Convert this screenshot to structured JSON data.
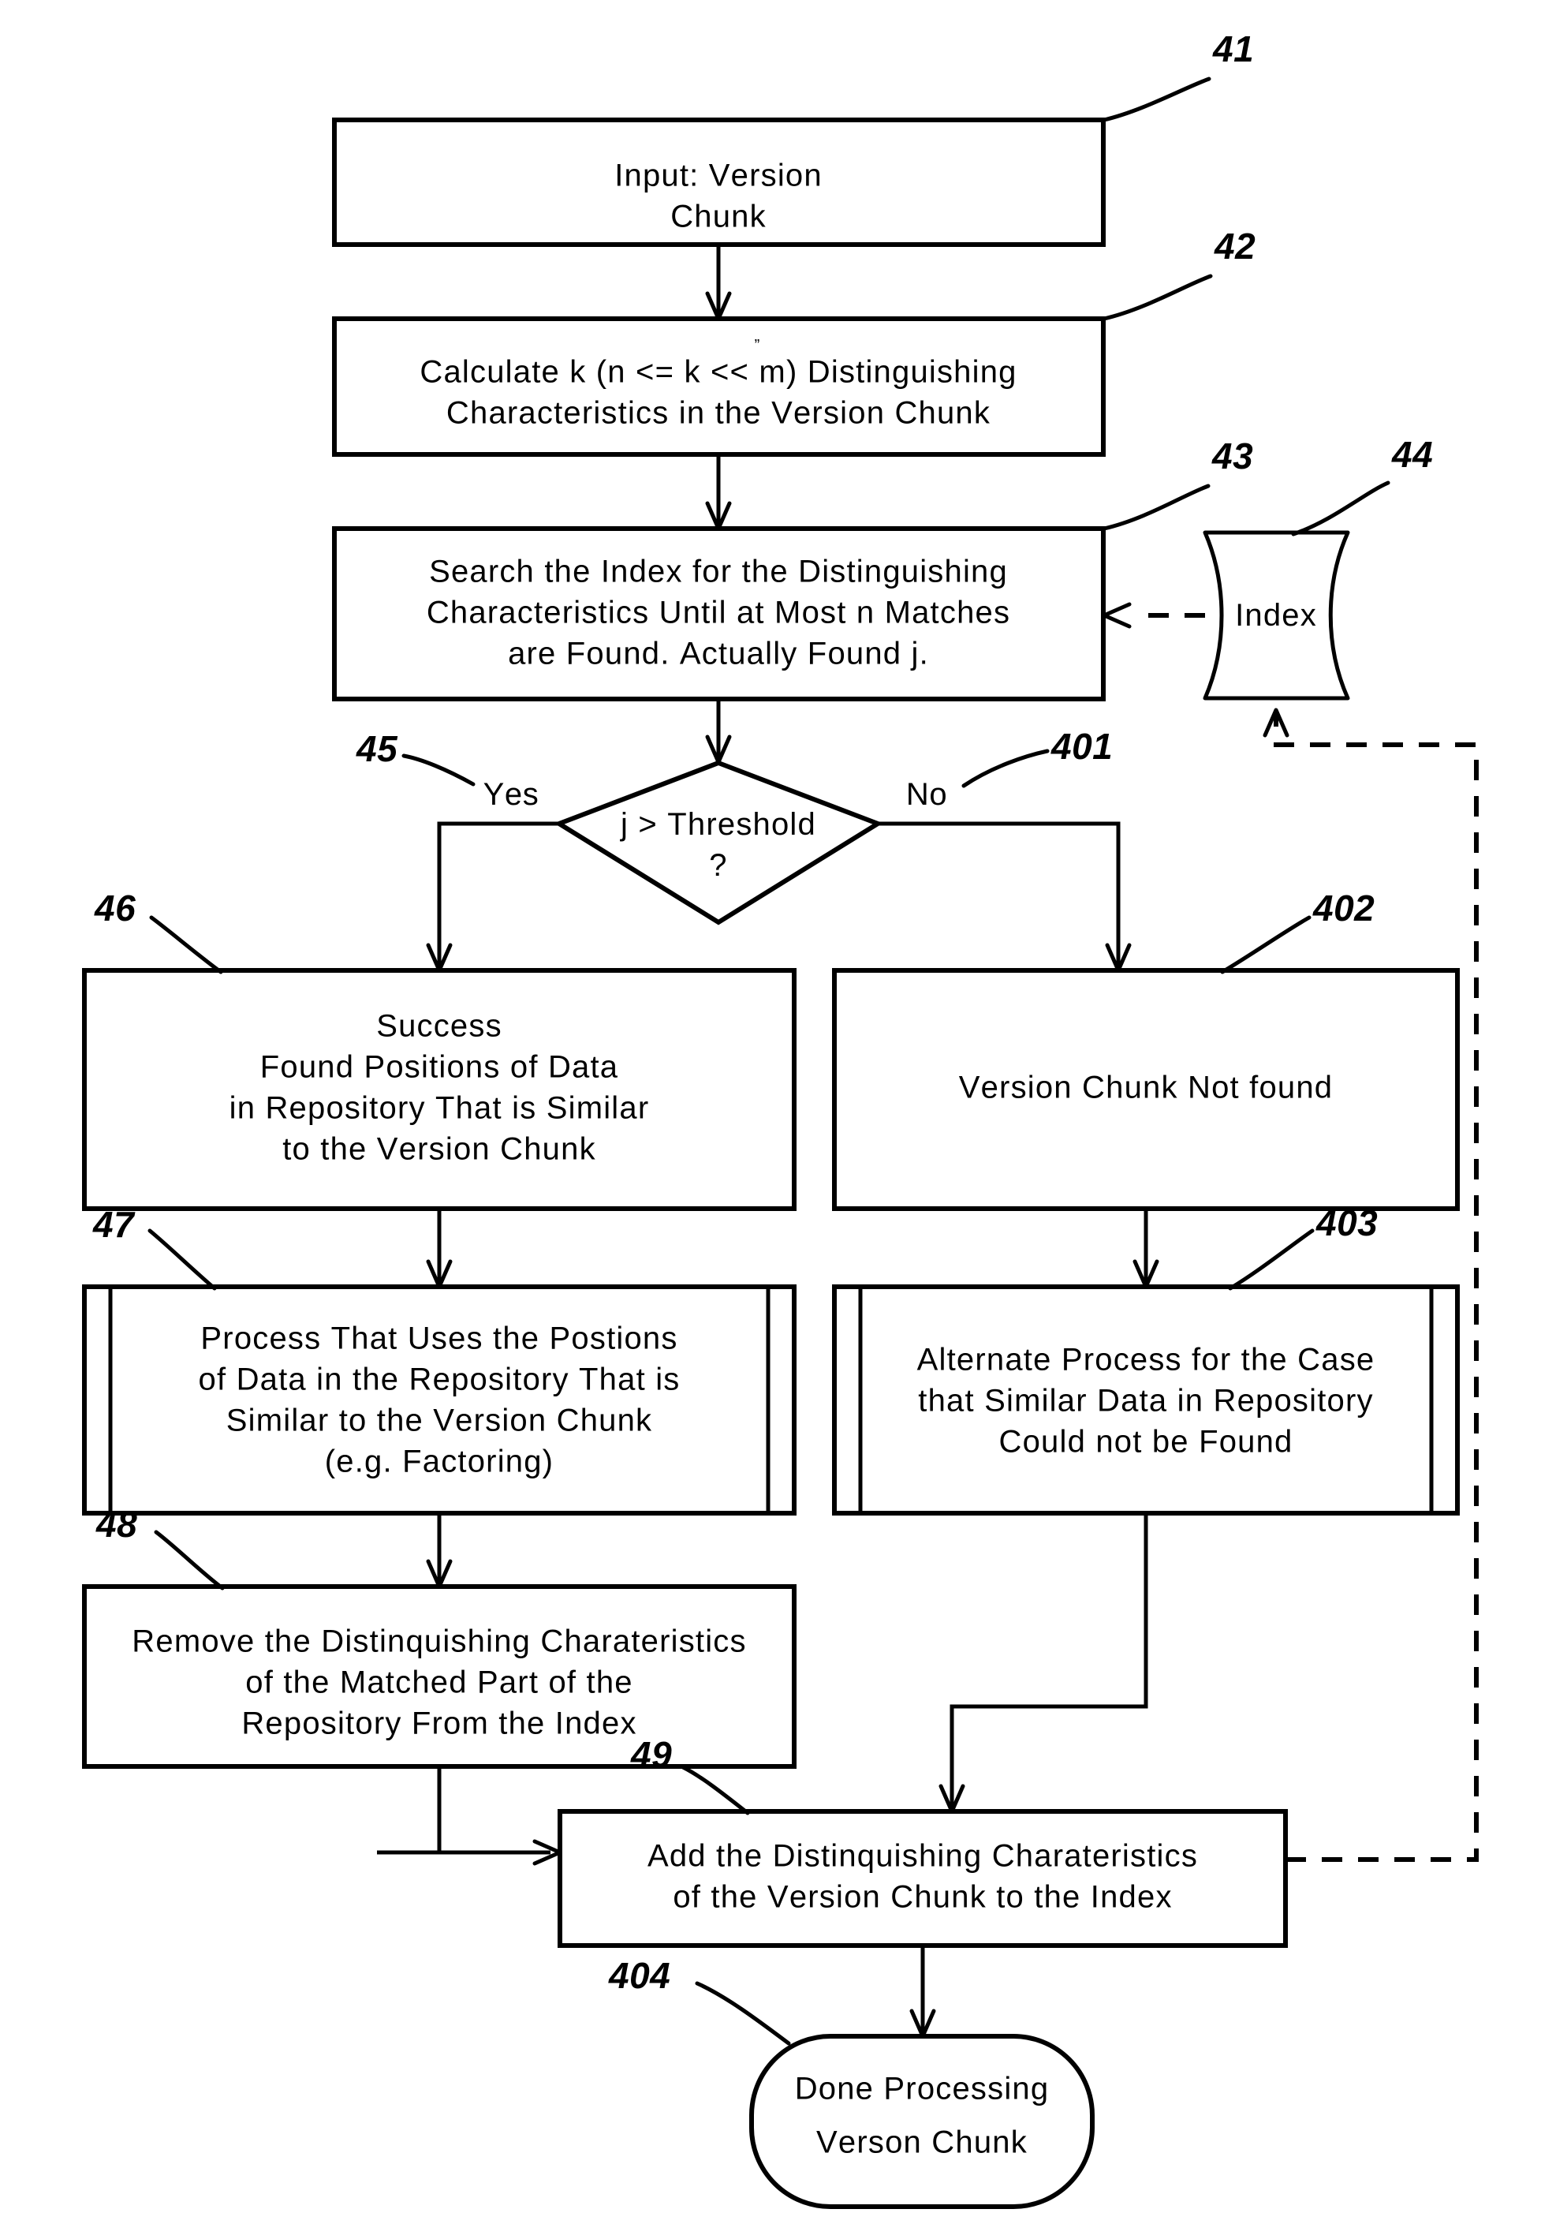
{
  "figure": {
    "title": "Version Chunk Similarity Search Flowchart",
    "background_color": "#ffffff",
    "line_color": "#000000"
  },
  "nodes": {
    "n41": {
      "ref": "41",
      "shape": "input-parallelogram",
      "lines": [
        "Input:  Version",
        "Chunk"
      ]
    },
    "n42": {
      "ref": "42",
      "shape": "process-rect",
      "lines": [
        "Calculate k (n <= k << m) Distinguishing",
        "Characteristics in the Version Chunk"
      ]
    },
    "n43": {
      "ref": "43",
      "shape": "process-rect",
      "lines": [
        "Search the Index for the Distinguishing",
        "Characteristics Until at Most n Matches",
        "are Found. Actually Found j."
      ]
    },
    "n44": {
      "ref": "44",
      "shape": "stored-data",
      "lines": [
        "Index"
      ]
    },
    "n45": {
      "ref": "45",
      "shape": "decision-diamond",
      "lines": [
        "j > Threshold",
        "?"
      ],
      "yes_label": "Yes",
      "no_label": "No"
    },
    "n401": {
      "ref": "401",
      "shape": "edge-annotation",
      "lines": [
        "No"
      ]
    },
    "n46": {
      "ref": "46",
      "shape": "process-rect",
      "lines": [
        "Success",
        "Found Positions of Data",
        "in Repository That is Similar",
        "to the Version Chunk"
      ]
    },
    "n402": {
      "ref": "402",
      "shape": "process-rect",
      "lines": [
        "Version Chunk Not found"
      ]
    },
    "n47": {
      "ref": "47",
      "shape": "predefined-process",
      "lines": [
        "Process That Uses the Postions",
        "of Data in the Repository That is",
        "Similar to the Version Chunk",
        "(e.g. Factoring)"
      ]
    },
    "n403": {
      "ref": "403",
      "shape": "predefined-process",
      "lines": [
        "Alternate Process for the Case",
        "that Similar Data in Repository",
        "Could not be Found"
      ]
    },
    "n48": {
      "ref": "48",
      "shape": "process-rect",
      "lines": [
        "Remove the Distinquishing Charateristics",
        "of the Matched Part of the",
        "Repository From the Index"
      ]
    },
    "n49": {
      "ref": "49",
      "shape": "process-rect",
      "lines": [
        "Add the Distinquishing Charateristics",
        "of the Version Chunk to the Index"
      ]
    },
    "n404": {
      "ref": "404",
      "shape": "terminator-rounded",
      "lines": [
        "Done Processing",
        "Verson Chunk"
      ]
    }
  }
}
